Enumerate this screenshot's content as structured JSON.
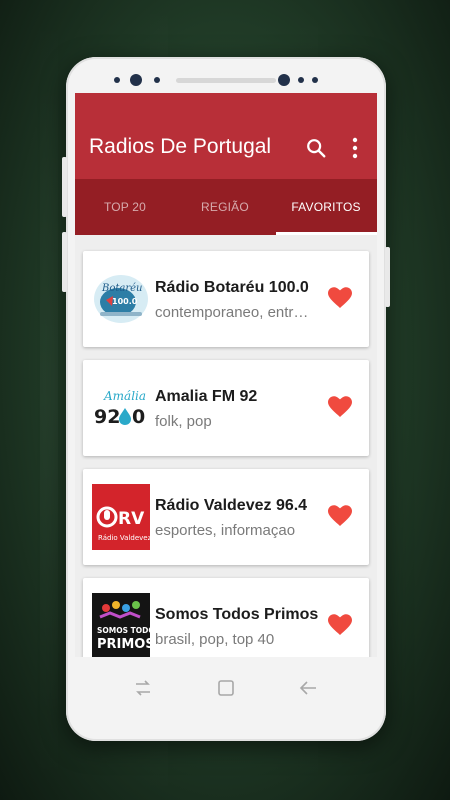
{
  "app": {
    "title": "Radios De Portugal",
    "accent_color": "#b82f38",
    "tab_bar_color": "#941e24"
  },
  "toolbar": {
    "search_icon": "search-icon",
    "more_icon": "more-vertical-icon"
  },
  "tabs": [
    {
      "label": "TOP 20",
      "active": false
    },
    {
      "label": "REGIÃO",
      "active": false
    },
    {
      "label": "FAVORITOS",
      "active": true
    }
  ],
  "stations": [
    {
      "name": "Rádio Botaréu 100.0",
      "genres": "contemporaneo, entretenimento",
      "favorite": true,
      "logo": "botareu-logo",
      "logo_text": "Botaréu 100.0 FM"
    },
    {
      "name": "Amalia FM 92",
      "genres": "folk, pop",
      "favorite": true,
      "logo": "amalia-logo",
      "logo_text": "Amália 92.0 FM"
    },
    {
      "name": "Rádio Valdevez 96.4",
      "genres": "esportes, informaçao",
      "favorite": true,
      "logo": "valdevez-logo",
      "logo_text": "RV Rádio Valdevez"
    },
    {
      "name": "Somos Todos Primos",
      "genres": "brasil, pop, top 40",
      "favorite": true,
      "logo": "somos-todos-primos-logo",
      "logo_text": "SOMOS TODOS PRIMOS"
    }
  ],
  "navbar": {
    "icons": [
      "recent-apps-icon",
      "home-icon",
      "back-icon"
    ]
  }
}
